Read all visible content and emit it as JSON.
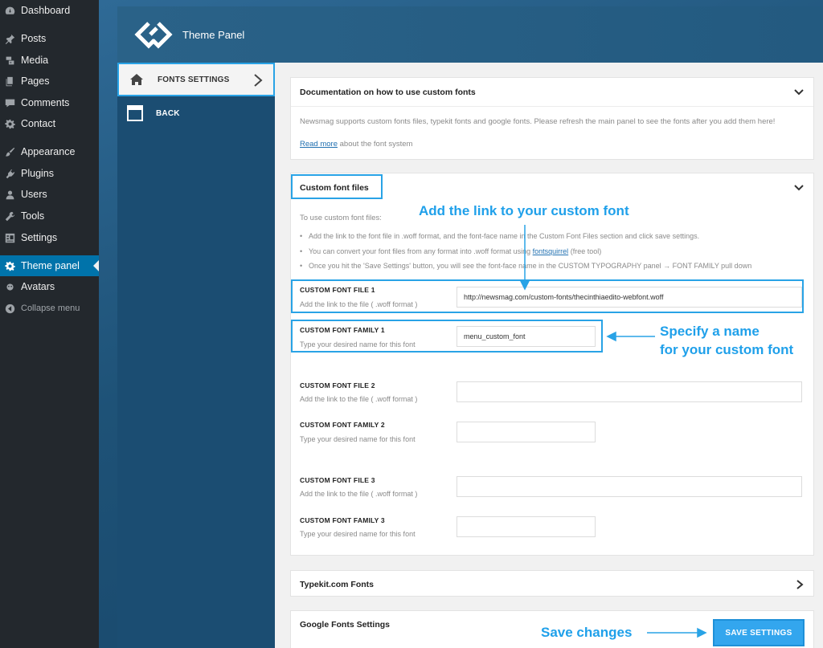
{
  "wp_menu": {
    "items": [
      {
        "label": "Dashboard",
        "icon": "dashboard-icon"
      },
      {
        "label": "Posts",
        "icon": "pin-icon"
      },
      {
        "label": "Media",
        "icon": "media-icon"
      },
      {
        "label": "Pages",
        "icon": "pages-icon"
      },
      {
        "label": "Comments",
        "icon": "comment-icon"
      },
      {
        "label": "Contact",
        "icon": "gear-icon"
      },
      {
        "label": "Appearance",
        "icon": "brush-icon"
      },
      {
        "label": "Plugins",
        "icon": "plugin-icon"
      },
      {
        "label": "Users",
        "icon": "user-icon"
      },
      {
        "label": "Tools",
        "icon": "wrench-icon"
      },
      {
        "label": "Settings",
        "icon": "settings-icon"
      },
      {
        "label": "Theme panel",
        "icon": "gear-icon"
      },
      {
        "label": "Avatars",
        "icon": "avatar-icon"
      },
      {
        "label": "Collapse menu",
        "icon": "collapse-icon"
      }
    ]
  },
  "panel": {
    "title": "Theme Panel",
    "menu": {
      "fonts_settings": "FONTS SETTINGS",
      "back": "BACK"
    }
  },
  "docs": {
    "title": "Documentation on how to use custom fonts",
    "text": "Newsmag supports custom fonts files, typekit fonts and google fonts. Please refresh the main panel to see the fonts after you add them here!",
    "read_more": "Read more",
    "read_more_suffix": "about the font system"
  },
  "custom_files": {
    "title": "Custom font files",
    "intro": "To use custom font files:",
    "bullet1": "Add the link to the font file in .woff format, and the font-face name in the Custom Font Files section and click save settings.",
    "bullet2_pre": "You can convert your font files from any format into .woff format using",
    "bullet2_link": "fontsquirrel",
    "bullet2_post": "(free tool)",
    "bullet3": "Once you hit the 'Save Settings' button, you will see the font-face name in the CUSTOM TYPOGRAPHY panel → FONT FAMILY pull down",
    "fields": [
      {
        "label": "CUSTOM FONT FILE 1",
        "help": "Add the link to the file ( .woff format )",
        "value": "http://newsmag.com/custom-fonts/thecinthiaedito-webfont.woff"
      },
      {
        "label": "CUSTOM FONT FAMILY 1",
        "help": "Type your desired name for this font",
        "value": "menu_custom_font"
      },
      {
        "label": "CUSTOM FONT FILE 2",
        "help": "Add the link to the file ( .woff format )",
        "value": ""
      },
      {
        "label": "CUSTOM FONT FAMILY 2",
        "help": "Type your desired name for this font",
        "value": ""
      },
      {
        "label": "CUSTOM FONT FILE 3",
        "help": "Add the link to the file ( .woff format )",
        "value": ""
      },
      {
        "label": "CUSTOM FONT FAMILY 3",
        "help": "Type your desired name for this font",
        "value": ""
      }
    ]
  },
  "typekit": {
    "title": "Typekit.com Fonts"
  },
  "google": {
    "title": "Google Fonts Settings"
  },
  "save_button": "SAVE SETTINGS",
  "annotations": {
    "add_link": "Add the link to your custom font",
    "specify_name_1": "Specify a name",
    "specify_name_2": "for your custom font",
    "save_changes": "Save changes"
  },
  "colors": {
    "accent": "#29a3e6",
    "wp_active": "#0073aa",
    "wp_sidebar": "#23282d"
  }
}
